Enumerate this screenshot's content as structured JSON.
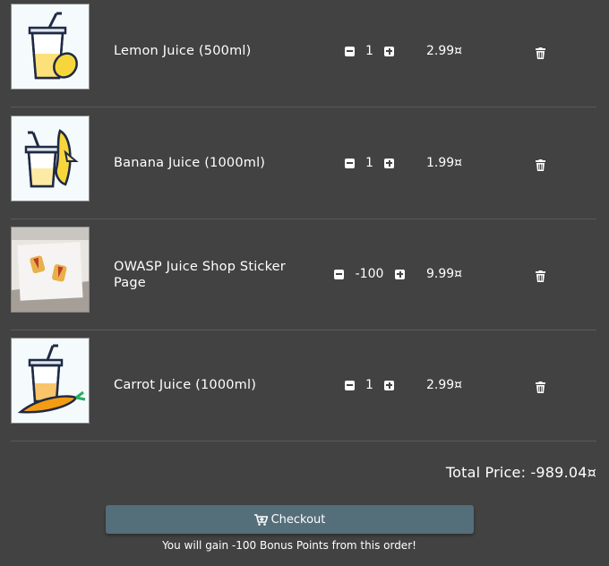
{
  "items": [
    {
      "name": "Lemon Juice (500ml)",
      "quantity": "1",
      "price": "2.99¤",
      "icon": "lemon-juice-icon"
    },
    {
      "name": "Banana Juice (1000ml)",
      "quantity": "1",
      "price": "1.99¤",
      "icon": "banana-juice-icon"
    },
    {
      "name": "OWASP Juice Shop Sticker Page",
      "quantity": "-100",
      "price": "9.99¤",
      "icon": "sticker-page-photo"
    },
    {
      "name": "Carrot Juice (1000ml)",
      "quantity": "1",
      "price": "2.99¤",
      "icon": "carrot-juice-icon"
    }
  ],
  "total": {
    "label": "Total Price: -989.04¤"
  },
  "checkout": {
    "label": "Checkout"
  },
  "bonus": {
    "text": "You will gain -100 Bonus Points from this order!"
  },
  "colors": {
    "background": "#424242",
    "checkout_button": "#546e7a",
    "divider": "#5a5a5a"
  }
}
